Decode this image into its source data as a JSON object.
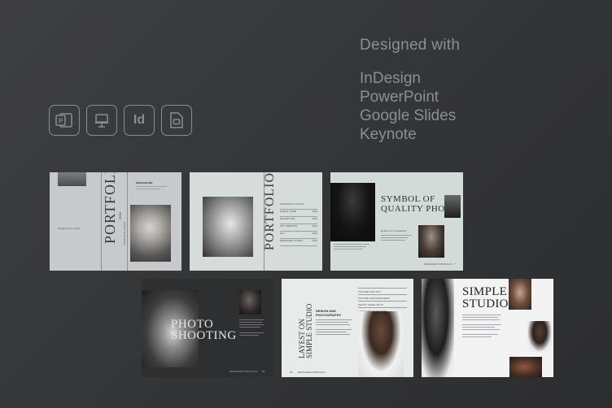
{
  "heading": "Designed with",
  "apps": [
    "InDesign",
    "PowerPoint",
    "Google Slides",
    "Keynote"
  ],
  "icons": [
    "powerpoint-icon",
    "keynote-icon",
    "indesign-icon",
    "google-slides-icon"
  ],
  "indesign_icon_text": "Id",
  "slides": {
    "s1": {
      "title": "PORTFOLIO",
      "year": "2024",
      "side_label": "PORTFOLIO LAYOUT",
      "small_head": "DESIGNNAME",
      "tag": "Designed for 3 years"
    },
    "s2": {
      "title": "PORTFOLIO",
      "rows": [
        "PORTFOLIO LAYOUT",
        "CLIENT NAME",
        "BUDGET 024",
        "ART CREATOR",
        "DAY",
        "DESIGNER STUDIO"
      ],
      "vals": [
        "2024",
        "2024",
        "2024",
        "2024",
        "2024"
      ]
    },
    "s3": {
      "title_line1": "SYMBOL OF",
      "title_line2": "QUALITY PHOTO",
      "sub": "Design for 3 presenting",
      "footer": "DESIGNER PORTFOLIO",
      "page": "7"
    },
    "s4": {
      "title_line1": "PHOTO",
      "title_line2": "SHOOTING",
      "footer": "DESIGNER PORTFOLIO",
      "page": "08"
    },
    "s5": {
      "vert_line1": "LAYEST ON",
      "vert_line2": "SIMPLE STUDIO",
      "head1": "DESIGN AND",
      "head2": "PHOTOGRAPHY",
      "rows": [
        "PICTURE FOR GIFT",
        "PICTURE FOR DESIGNERS",
        "PHOTO THESE GIFTS",
        "LATEST ON DESIGNERS"
      ],
      "footer": "DESIGNER PORTFOLIO",
      "page": "28"
    },
    "s6": {
      "title_line1": "SIMPLE",
      "title_line2": "STUDIO"
    }
  },
  "colors": {
    "background": "#37383a",
    "text": "#8d8e90",
    "slide_light": "#c9cdcf",
    "slide_sage": "#d3dbd8",
    "slide_dark": "#2e2f31"
  }
}
